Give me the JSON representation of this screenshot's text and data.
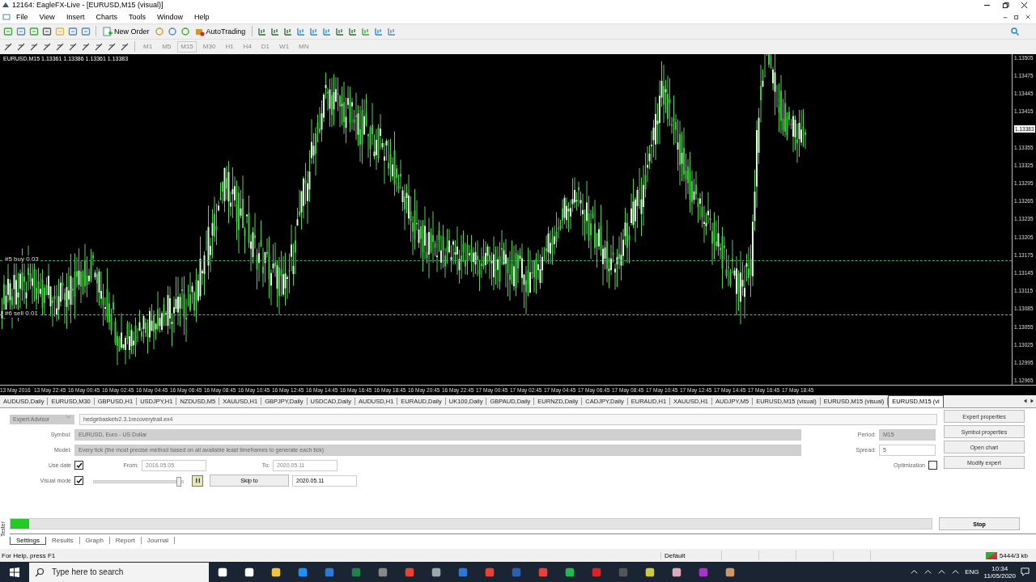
{
  "window": {
    "title": "12164: EagleFX-Live - [EURUSD,M15 (visual)]"
  },
  "menu": [
    "File",
    "View",
    "Insert",
    "Charts",
    "Tools",
    "Window",
    "Help"
  ],
  "toolbar": {
    "new_order": "New Order",
    "autotrading": "AutoTrading"
  },
  "timeframes": [
    {
      "label": "M1",
      "selected": false,
      "disabled": true
    },
    {
      "label": "M5",
      "selected": false,
      "disabled": true
    },
    {
      "label": "M15",
      "selected": true,
      "disabled": true
    },
    {
      "label": "M30",
      "selected": false,
      "disabled": true
    },
    {
      "label": "H1",
      "selected": false,
      "disabled": true
    },
    {
      "label": "H4",
      "selected": false,
      "disabled": true
    },
    {
      "label": "D1",
      "selected": false,
      "disabled": true
    },
    {
      "label": "W1",
      "selected": false,
      "disabled": true
    },
    {
      "label": "MN",
      "selected": false,
      "disabled": true
    }
  ],
  "chart": {
    "header": "EURUSD,M15 1.13361 1.13386 1.13361 1.13383",
    "orders": [
      {
        "label": "#5 buy 0.03"
      },
      {
        "label": "#6 sell 0.01"
      }
    ],
    "price_labels": [
      "1.13505",
      "1.13475",
      "1.13445",
      "1.13415",
      "1.13355",
      "1.13325",
      "1.13295",
      "1.13265",
      "1.13235",
      "1.13205",
      "1.13175",
      "1.13145",
      "1.13115",
      "1.13085",
      "1.13055",
      "1.13025",
      "1.12995",
      "1.12965"
    ],
    "current_price": "1.13383",
    "time_labels": [
      "13 May 2016",
      "13 May 22:45",
      "16 May 00:45",
      "16 May 02:45",
      "16 May 04:45",
      "16 May 06:45",
      "16 May 08:45",
      "16 May 10:45",
      "16 May 12:45",
      "16 May 14:45",
      "16 May 16:45",
      "16 May 18:45",
      "16 May 20:45",
      "16 May 22:45",
      "17 May 00:45",
      "17 May 02:45",
      "17 May 04:45",
      "17 May 06:45",
      "17 May 08:45",
      "17 May 10:45",
      "17 May 12:45",
      "17 May 14:45",
      "17 May 16:45",
      "17 May 18:45"
    ]
  },
  "chart_tabs": [
    {
      "label": "AUDUSD,Daily",
      "selected": false
    },
    {
      "label": "EURUSD,M30",
      "selected": false
    },
    {
      "label": "GBPUSD,H1",
      "selected": false
    },
    {
      "label": "USDJPY,H1",
      "selected": false
    },
    {
      "label": "NZDUSD,M5",
      "selected": false
    },
    {
      "label": "XAUUSD,H1",
      "selected": false
    },
    {
      "label": "GBPJPY,Daily",
      "selected": false
    },
    {
      "label": "USDCAD,Daily",
      "selected": false
    },
    {
      "label": "AUDUSD,H1",
      "selected": false
    },
    {
      "label": "EURAUD,Daily",
      "selected": false
    },
    {
      "label": "UK100,Daily",
      "selected": false
    },
    {
      "label": "GBPAUD,Daily",
      "selected": false
    },
    {
      "label": "EURNZD,Daily",
      "selected": false
    },
    {
      "label": "CADJPY,Daily",
      "selected": false
    },
    {
      "label": "EURAUD,H1",
      "selected": false
    },
    {
      "label": "XAUUSD,H1",
      "selected": false
    },
    {
      "label": "AUDJPY,M5",
      "selected": false
    },
    {
      "label": "EURUSD,M15 (visual)",
      "selected": false
    },
    {
      "label": "EURUSD,M15 (visual)",
      "selected": false
    },
    {
      "label": "EURUSD,M15 (vi",
      "selected": true
    }
  ],
  "tester": {
    "side_label": "Tester",
    "program_type": "Expert Advisor",
    "expert": "hedgebasketv2.3.1recoverytrail.ex4",
    "fields": [
      {
        "label": "Symbol:",
        "value": "EURUSD, Euro - US Dollar",
        "disabled": true
      },
      {
        "label": "Model:",
        "value": "Every tick (the most precise method based on all available least timeframes to generate each tick)",
        "disabled": true
      }
    ],
    "right_fields": [
      {
        "label": "Period:",
        "value": "M15",
        "disabled": true
      },
      {
        "label": "Spread:",
        "value": "5",
        "disabled": false
      }
    ],
    "use_date": {
      "label": "Use date",
      "checked": true
    },
    "from": {
      "label": "From:",
      "value": "2016.05.05",
      "disabled": true
    },
    "to": {
      "label": "To:",
      "value": "2020.05.11",
      "disabled": true
    },
    "visual_mode": {
      "label": "Visual mode",
      "checked": true
    },
    "speed": {
      "level": 0.95
    },
    "skip_to": "Skip to",
    "skip_date": "2020.05.11",
    "optimization": {
      "label": "Optimization",
      "checked": false
    },
    "buttons": [
      "Expert properties",
      "Symbol properties",
      "Open chart",
      "Modify expert"
    ],
    "progress": {
      "level": 0.02
    },
    "stop": "Stop",
    "tabs": [
      {
        "label": "Settings",
        "selected": true
      },
      {
        "label": "Results",
        "selected": false
      },
      {
        "label": "Graph",
        "selected": false
      },
      {
        "label": "Report",
        "selected": false
      },
      {
        "label": "Journal",
        "selected": false
      }
    ]
  },
  "status_bar": {
    "help": "For Help, press F1",
    "profile": "Default",
    "traffic": "5444/3 kb"
  },
  "taskbar": {
    "search_placeholder": "Type here to search",
    "language": "ENG",
    "time": "10:34",
    "date": "11/05/2020"
  }
}
